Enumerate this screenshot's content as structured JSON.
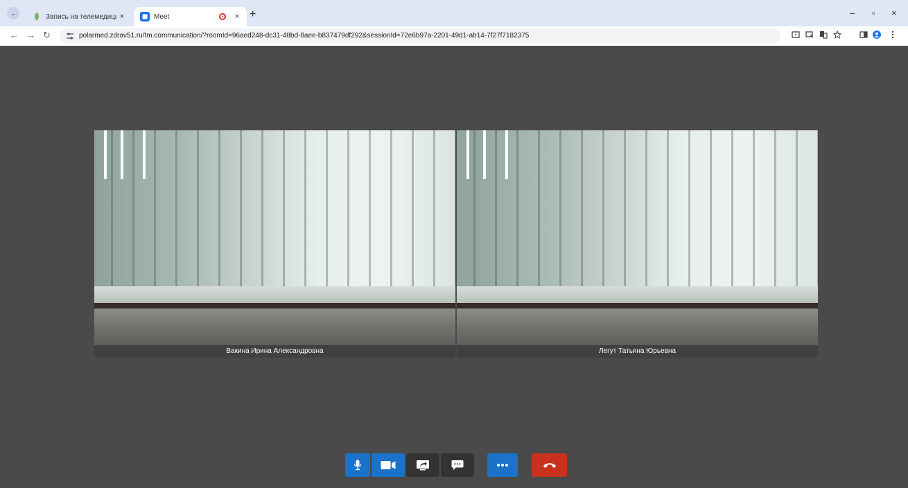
{
  "browser": {
    "tabs": [
      {
        "title": "Запись на телемедицинскую",
        "close": "×",
        "favicon": "leaf-icon",
        "active": false
      },
      {
        "title": "Meet",
        "close": "×",
        "favicon": "meet-icon",
        "active": true,
        "recording": true
      }
    ],
    "tab_menu": "⌄",
    "new_tab": "+",
    "window": {
      "minimize": "–",
      "restore": "▫",
      "close": "×"
    },
    "nav": {
      "back": "←",
      "forward": "→",
      "reload": "↻"
    },
    "url": "polarmed.zdrav51.ru/tm.communication/?roomId=96aed248-dc31-48bd-8aee-b837479df292&sessionId=72e6b97a-2201-49d1-ab14-7f27f7182375",
    "toolbar_icons": [
      "cast-icon",
      "screen-share-icon",
      "translate-icon",
      "star-icon",
      "side-panel-icon",
      "profile-icon",
      "menu-icon"
    ]
  },
  "call": {
    "participants": [
      {
        "name": "Вакина Ирина Александровна"
      },
      {
        "name": "Легут Татьяна Юрьевна"
      }
    ],
    "controls": [
      {
        "name": "microphone",
        "icon": "microphone-icon",
        "state": "on",
        "color": "#1a73c9"
      },
      {
        "name": "camera",
        "icon": "camera-icon",
        "state": "on",
        "color": "#1a73c9"
      },
      {
        "name": "share-screen",
        "icon": "share-screen-icon",
        "color": "#333333"
      },
      {
        "name": "chat",
        "icon": "chat-icon",
        "color": "#333333"
      },
      {
        "name": "more",
        "icon": "more-icon",
        "color": "#1a73c9"
      },
      {
        "name": "hang-up",
        "icon": "hang-up-icon",
        "color": "#c9321c"
      }
    ],
    "background": "#4a4a4a"
  }
}
